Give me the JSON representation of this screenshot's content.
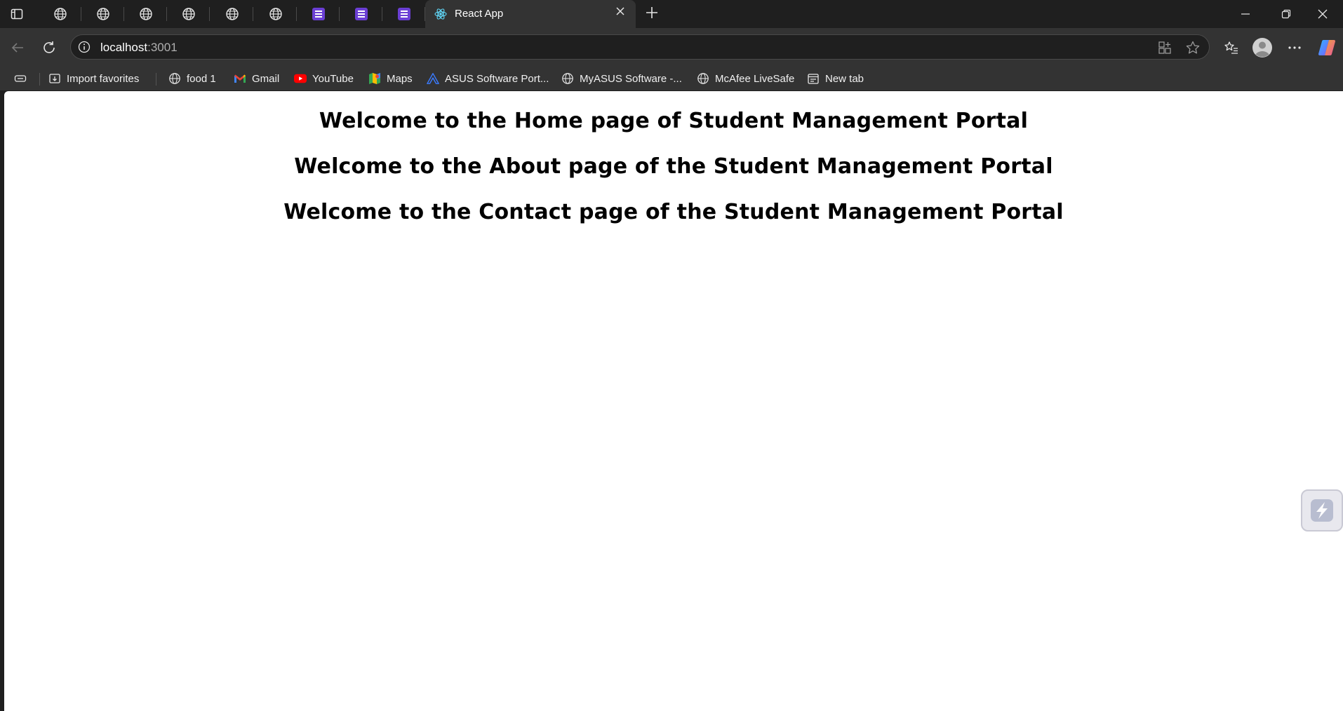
{
  "browser": {
    "active_tab": {
      "title": "React App",
      "favicon": "react-icon"
    },
    "pinned_tabs": [
      {
        "icon": "globe-icon"
      },
      {
        "icon": "globe-icon"
      },
      {
        "icon": "globe-icon"
      },
      {
        "icon": "globe-icon"
      },
      {
        "icon": "globe-icon"
      },
      {
        "icon": "globe-icon"
      },
      {
        "icon": "forms-icon"
      },
      {
        "icon": "forms-icon"
      },
      {
        "icon": "forms-icon"
      }
    ],
    "address": {
      "host": "localhost",
      "port": ":3001"
    },
    "favorites": [
      {
        "label": "Import favorites",
        "icon": "import-icon"
      },
      {
        "label": "food 1",
        "icon": "globe-icon"
      },
      {
        "label": "Gmail",
        "icon": "gmail-icon"
      },
      {
        "label": "YouTube",
        "icon": "youtube-icon"
      },
      {
        "label": "Maps",
        "icon": "maps-icon"
      },
      {
        "label": "ASUS Software Port...",
        "icon": "asus-icon"
      },
      {
        "label": "MyASUS Software -...",
        "icon": "globe-icon"
      },
      {
        "label": "McAfee LiveSafe",
        "icon": "globe-icon"
      },
      {
        "label": "New tab",
        "icon": "newtab-icon"
      }
    ]
  },
  "page": {
    "headings": [
      "Welcome to the Home page of Student Management Portal",
      "Welcome to the About page of the Student Management Portal",
      "Welcome to the Contact page of the Student Management Portal"
    ]
  },
  "colors": {
    "chrome_dark": "#1f1f1f",
    "chrome_toolbar": "#333333",
    "page_background": "#ffffff",
    "forms_purple": "#6b3fd4"
  }
}
